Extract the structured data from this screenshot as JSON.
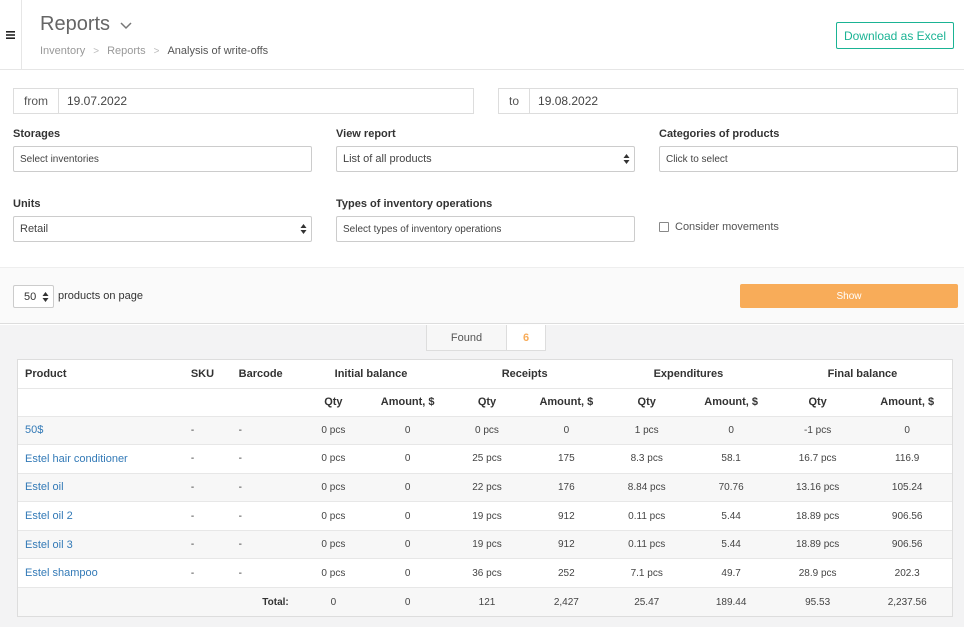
{
  "header": {
    "title": "Reports",
    "breadcrumb": [
      "Inventory",
      "Reports",
      "Analysis of write-offs"
    ],
    "excel_button": "Download as Excel"
  },
  "filters": {
    "from_label": "from",
    "from_value": "19.07.2022",
    "to_label": "to",
    "to_value": "19.08.2022",
    "storages_label": "Storages",
    "storages_value": "Select inventories",
    "view_report_label": "View report",
    "view_report_value": "List of all products",
    "categories_label": "Categories of products",
    "categories_value": "Click to select",
    "units_label": "Units",
    "units_value": "Retail",
    "types_label": "Types of inventory operations",
    "types_value": "Select types of inventory operations",
    "consider_label": "Consider movements"
  },
  "paging": {
    "per_page_value": "50",
    "per_page_label": "products on page",
    "show_button": "Show"
  },
  "found": {
    "label": "Found",
    "count": "6"
  },
  "table": {
    "headers": {
      "product": "Product",
      "sku": "SKU",
      "barcode": "Barcode",
      "initial": "Initial balance",
      "receipts": "Receipts",
      "expenditures": "Expenditures",
      "final": "Final balance",
      "qty": "Qty",
      "amount": "Amount, $"
    },
    "rows": [
      [
        "50$",
        "-",
        "-",
        "0 pcs",
        "0",
        "0 pcs",
        "0",
        "1 pcs",
        "0",
        "-1 pcs",
        "0"
      ],
      [
        "Estel hair conditioner",
        "-",
        "-",
        "0 pcs",
        "0",
        "25 pcs",
        "175",
        "8.3 pcs",
        "58.1",
        "16.7 pcs",
        "116.9"
      ],
      [
        "Estel oil",
        "-",
        "-",
        "0 pcs",
        "0",
        "22 pcs",
        "176",
        "8.84 pcs",
        "70.76",
        "13.16 pcs",
        "105.24"
      ],
      [
        "Estel oil 2",
        "-",
        "-",
        "0 pcs",
        "0",
        "19 pcs",
        "912",
        "0.11 pcs",
        "5.44",
        "18.89 pcs",
        "906.56"
      ],
      [
        "Estel oil 3",
        "-",
        "-",
        "0 pcs",
        "0",
        "19 pcs",
        "912",
        "0.11 pcs",
        "5.44",
        "18.89 pcs",
        "906.56"
      ],
      [
        "Estel shampoo",
        "-",
        "-",
        "0 pcs",
        "0",
        "36 pcs",
        "252",
        "7.1 pcs",
        "49.7",
        "28.9 pcs",
        "202.3"
      ]
    ],
    "total": {
      "label": "Total:",
      "values": [
        "0",
        "0",
        "121",
        "2,427",
        "25.47",
        "189.44",
        "95.53",
        "2,237.56"
      ]
    }
  },
  "colors": {
    "accent_green": "#1ab394",
    "accent_orange": "#f8ac59",
    "link_blue": "#337ab7"
  }
}
